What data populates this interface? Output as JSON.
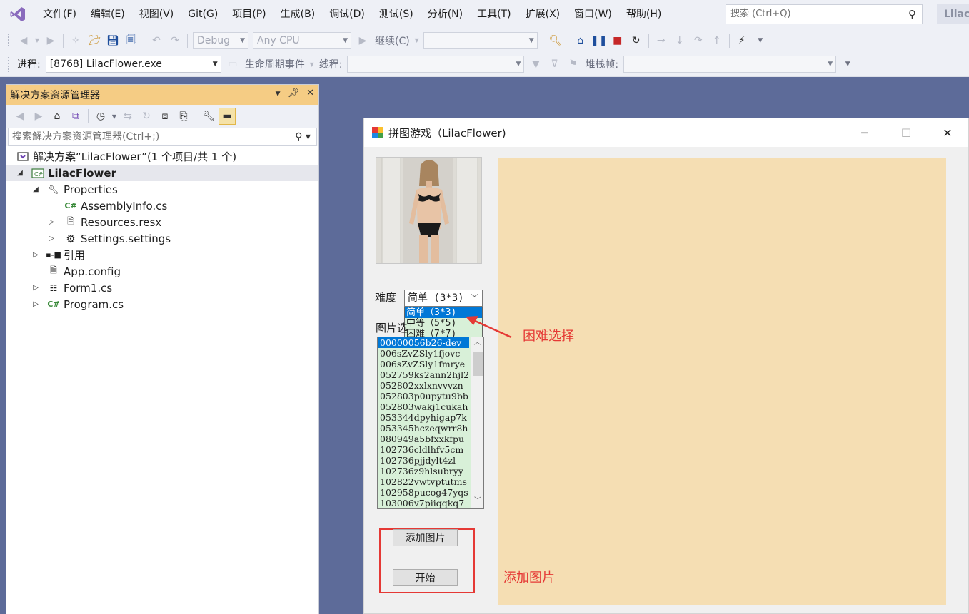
{
  "menu": {
    "items": [
      "文件(F)",
      "编辑(E)",
      "视图(V)",
      "Git(G)",
      "项目(P)",
      "生成(B)",
      "调试(D)",
      "测试(S)",
      "分析(N)",
      "工具(T)",
      "扩展(X)",
      "窗口(W)",
      "帮助(H)"
    ],
    "search_placeholder": "搜索 (Ctrl+Q)",
    "solution_chip": "Lilac"
  },
  "toolbar1": {
    "config": "Debug",
    "platform": "Any CPU",
    "continue_label": "继续(C)"
  },
  "toolbar2": {
    "process_label": "进程:",
    "process_value": "[8768] LilacFlower.exe",
    "lifecycle_label": "生命周期事件",
    "thread_label": "线程:",
    "stackframe_label": "堆栈帧:"
  },
  "solution_explorer": {
    "title": "解决方案资源管理器",
    "search_placeholder": "搜索解决方案资源管理器(Ctrl+;)",
    "tree": [
      {
        "label": "解决方案“LilacFlower”(1 个项目/共 1 个)",
        "icon": "solution-icon",
        "level": 0,
        "expander": ""
      },
      {
        "label": "LilacFlower",
        "icon": "csharp-project-icon",
        "level": 0,
        "expander": "◢",
        "bold": true,
        "selected": true
      },
      {
        "label": "Properties",
        "icon": "wrench-icon",
        "level": 1,
        "expander": "◢"
      },
      {
        "label": "AssemblyInfo.cs",
        "icon": "csharp-file-icon",
        "level": 2,
        "expander": ""
      },
      {
        "label": "Resources.resx",
        "icon": "resource-file-icon",
        "level": 2,
        "expander": "▷"
      },
      {
        "label": "Settings.settings",
        "icon": "gear-icon",
        "level": 2,
        "expander": "▷"
      },
      {
        "label": "引用",
        "icon": "references-icon",
        "level": 1,
        "expander": "▷"
      },
      {
        "label": "App.config",
        "icon": "config-file-icon",
        "level": 1,
        "expander": ""
      },
      {
        "label": "Form1.cs",
        "icon": "form-file-icon",
        "level": 1,
        "expander": "▷"
      },
      {
        "label": "Program.cs",
        "icon": "csharp-file-icon",
        "level": 1,
        "expander": "▷"
      }
    ]
  },
  "form": {
    "title": "拼图游戏（LilacFlower)",
    "difficulty_label": "难度",
    "difficulty_value": "简单 (3*3)",
    "difficulty_options": [
      "简单（3*3)",
      "中等（5*5)",
      "困难（7*7)"
    ],
    "picture_label": "图片选",
    "picture_list": [
      "00000056b26-dev",
      "006sZvZSly1fjovc",
      "006sZvZSly1fmrye",
      "052759ks2ann2hjl2",
      "052802xxlxnvvvzn",
      "052803p0upytu9bb",
      "052803wakj1cukah",
      "053344dpyhigap7k",
      "053345hczeqwrr8h",
      "080949a5bfxxkfpu",
      "102736cldlhfv5cm",
      "102736pjjdylt4zl",
      "102736z9hlsubryy",
      "102822vwtvptutms",
      "102958pucog47yqs",
      "103006v7piiqqkq7"
    ],
    "add_image_button": "添加图片",
    "start_button": "开始",
    "board_color": "#f5deb3"
  },
  "annotations": {
    "difficulty_note": "困难选择",
    "add_image_note": "添加图片"
  }
}
